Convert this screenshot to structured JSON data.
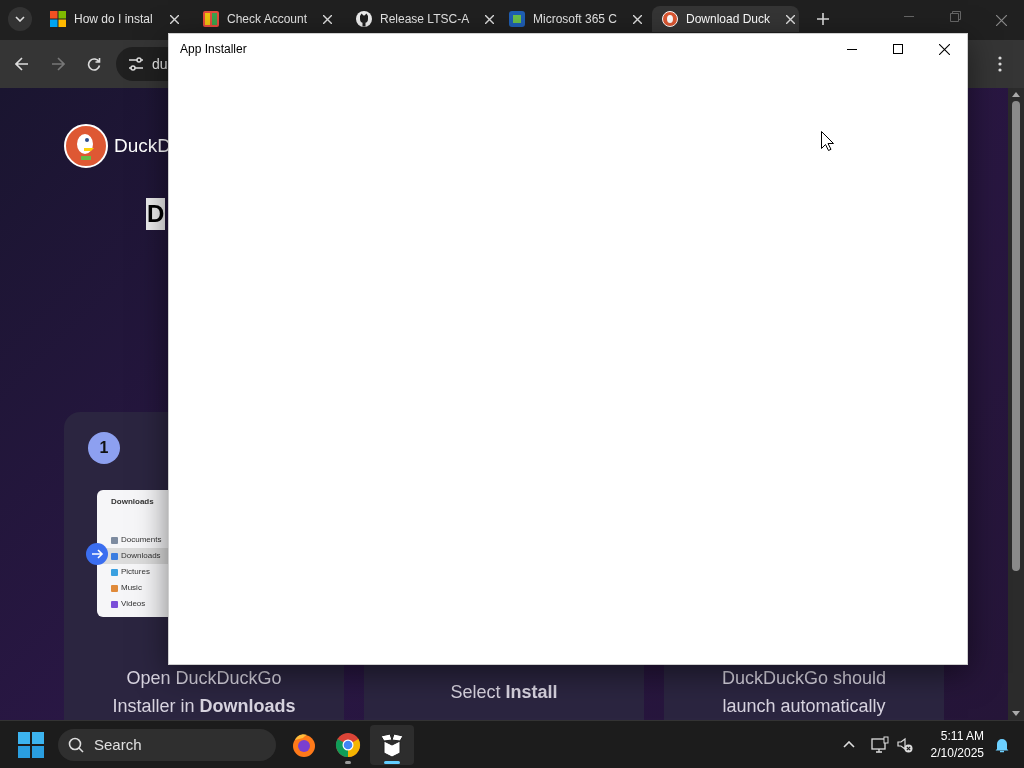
{
  "browser": {
    "tabs": [
      {
        "title": "How do I instal",
        "kind": "windows",
        "selected": false
      },
      {
        "title": "Check Account",
        "kind": "tiles",
        "selected": false
      },
      {
        "title": "Release LTSC-A",
        "kind": "github",
        "selected": false
      },
      {
        "title": "Microsoft 365 C",
        "kind": "office",
        "selected": false
      },
      {
        "title": "Download Duck",
        "kind": "duck",
        "selected": true
      }
    ],
    "address": "du"
  },
  "page": {
    "logo_text": "DuckD",
    "heading": "D",
    "step_number": "1",
    "explorer": {
      "title": "Downloads",
      "items": [
        {
          "label": "Documents",
          "selected": false
        },
        {
          "label": "Downloads",
          "selected": true
        },
        {
          "label": "Pictures",
          "selected": false
        },
        {
          "label": "Music",
          "selected": false
        },
        {
          "label": "Videos",
          "selected": false
        }
      ]
    },
    "steps": [
      {
        "text": "Open DuckDuckGo Installer in **Downloads**"
      },
      {
        "text": "Select **Install**"
      },
      {
        "text": "DuckDuckGo should launch automatically"
      }
    ]
  },
  "dialog": {
    "title": "App Installer"
  },
  "taskbar": {
    "search_placeholder": "Search",
    "apps": [
      {
        "kind": "firefox",
        "running": false,
        "active": false
      },
      {
        "kind": "chrome",
        "running": true,
        "active": false
      },
      {
        "kind": "installer",
        "running": true,
        "active": true
      }
    ],
    "time": "5:11 AM",
    "date": "2/10/2025"
  }
}
